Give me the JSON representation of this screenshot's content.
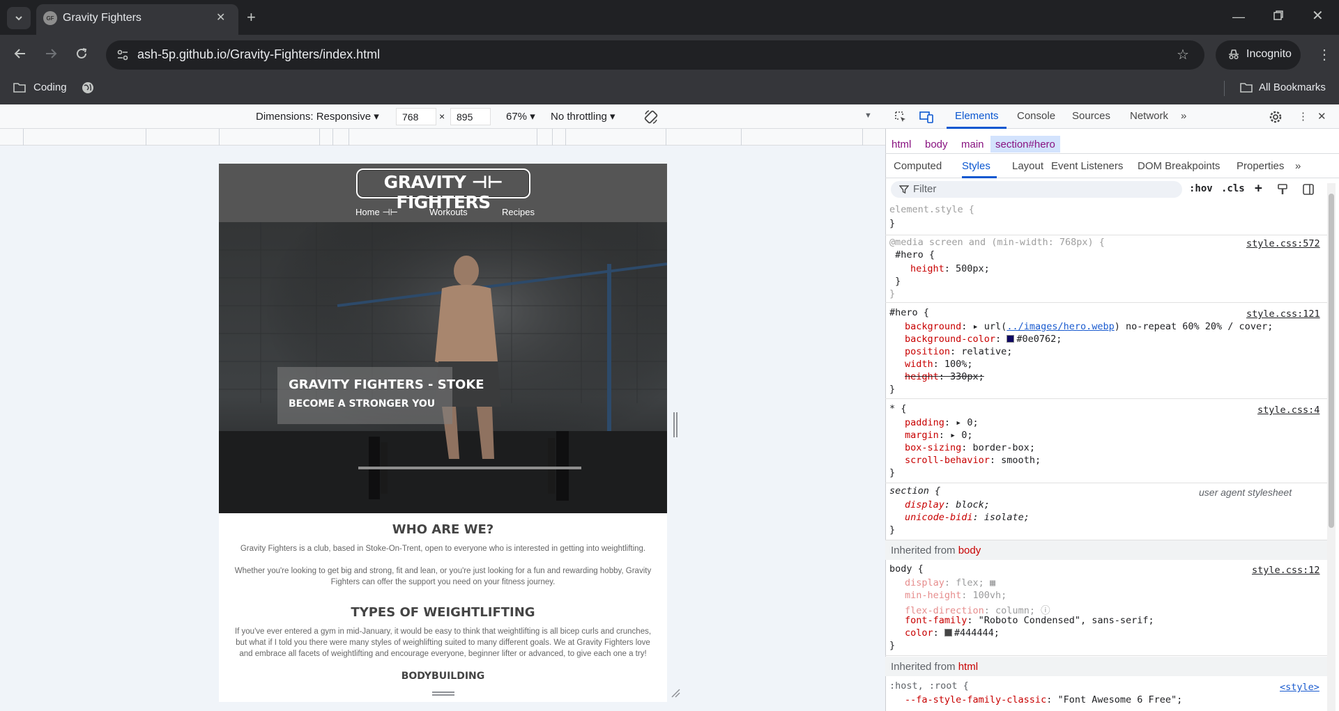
{
  "browser": {
    "tab_title": "Gravity Fighters",
    "favicon_text": "GF",
    "url": "ash-5p.github.io/Gravity-Fighters/index.html",
    "incognito_label": "Incognito",
    "bookmarks": {
      "coding": "Coding",
      "all": "All Bookmarks"
    }
  },
  "device_toolbar": {
    "dimensions": "Dimensions: Responsive",
    "width": "768",
    "times": "×",
    "height": "895",
    "zoom": "67%",
    "throttling": "No throttling"
  },
  "site": {
    "logo": "GRAVITY ⊣⊢ FIGHTERS",
    "nav": {
      "home": "Home",
      "workouts": "Workouts",
      "recipes": "Recipes"
    },
    "hero_title": "GRAVITY FIGHTERS - STOKE",
    "hero_subtitle": "BECOME A STRONGER YOU",
    "who_heading": "WHO ARE WE?",
    "who_p1": "Gravity Fighters is a club, based in Stoke-On-Trent, open to everyone who is interested in getting into weightlifting.",
    "who_p2": "Whether you're looking to get big and strong, fit and lean, or you're just looking for a fun and rewarding hobby, Gravity Fighters can offer the support you need on your fitness journey.",
    "types_heading": "TYPES OF WEIGHTLIFTING",
    "types_p": "If you've ever entered a gym in mid-January, it would be easy to think that weightlifting is all bicep curls and crunches, but what if I told you there were many styles of weighlifting suited to many different goals. We at Gravity Fighters love and embrace all facets of weightlifting and encourage everyone, beginner lifter or advanced, to give each one a try!",
    "bodybuilding_heading": "BODYBUILDING"
  },
  "devtools": {
    "tabs": {
      "elements": "Elements",
      "console": "Console",
      "sources": "Sources",
      "network": "Network"
    },
    "breadcrumb": [
      "html",
      "body",
      "main",
      "section#hero"
    ],
    "subtabs": {
      "computed": "Computed",
      "styles": "Styles",
      "layout": "Layout",
      "listeners": "Event Listeners",
      "dom_bp": "DOM Breakpoints",
      "properties": "Properties"
    },
    "filter_placeholder": "Filter",
    "hov": ":hov",
    "cls": ".cls",
    "inherited_body": "body",
    "inherited_html": "html",
    "inherited_prefix": "Inherited from ",
    "sources": {
      "media": "style.css:572",
      "hero": "style.css:121",
      "star": "style.css:4",
      "ua": "user agent stylesheet",
      "body": "style.css:12",
      "root": "<style>"
    },
    "lines": {
      "el": "element.style {",
      "close": "}",
      "media": "@media screen and (min-width: 768px) {",
      "hero_sel": " #hero {",
      "hero_h_p": "height",
      "hero_h_v": ": 500px;",
      "hero_close": " }",
      "hero2_sel": "#hero {",
      "bg_p": "background",
      "bg_pre": ": ▸ url(",
      "bg_link": "../images/hero.webp",
      "bg_post": ") no-repeat 60% 20% / cover;",
      "bgc_p": "background-color",
      "bgc_v": "#0e0762;",
      "pos_p": "position",
      "pos_v": ": relative;",
      "w_p": "width",
      "w_v": ": 100%;",
      "h_p": "height",
      "h_v": ": 330px;",
      "star_sel": "* {",
      "pad_p": "padding",
      "pad_v": ": ▸ 0;",
      "mar_p": "margin",
      "mar_v": ": ▸ 0;",
      "bs_p": "box-sizing",
      "bs_v": ": border-box;",
      "sb_p": "scroll-behavior",
      "sb_v": ": smooth;",
      "sec_sel": "section {",
      "disp_p": "display",
      "disp_v": ": block;",
      "ub_p": "unicode-bidi",
      "ub_v": ": isolate;",
      "body_sel": "body {",
      "bd_p": "display",
      "bd_v": ": flex;",
      "mh_p": "min-height",
      "mh_v": ": 100vh;",
      "fd_p": "flex-direction",
      "fd_v": ": column;",
      "ff_p": "font-family",
      "ff_v": ": \"Roboto Condensed\", sans-serif;",
      "c_p": "color",
      "c_v": "#444444;",
      "root_sel": ":host, :root {",
      "fa_p": "--fa-style-family-classic",
      "fa_v": ": \"Font Awesome 6 Free\";"
    }
  },
  "colors": {
    "bg_swatch": "#0e0762",
    "color_swatch": "#444444",
    "accent": "#0b57d0"
  }
}
